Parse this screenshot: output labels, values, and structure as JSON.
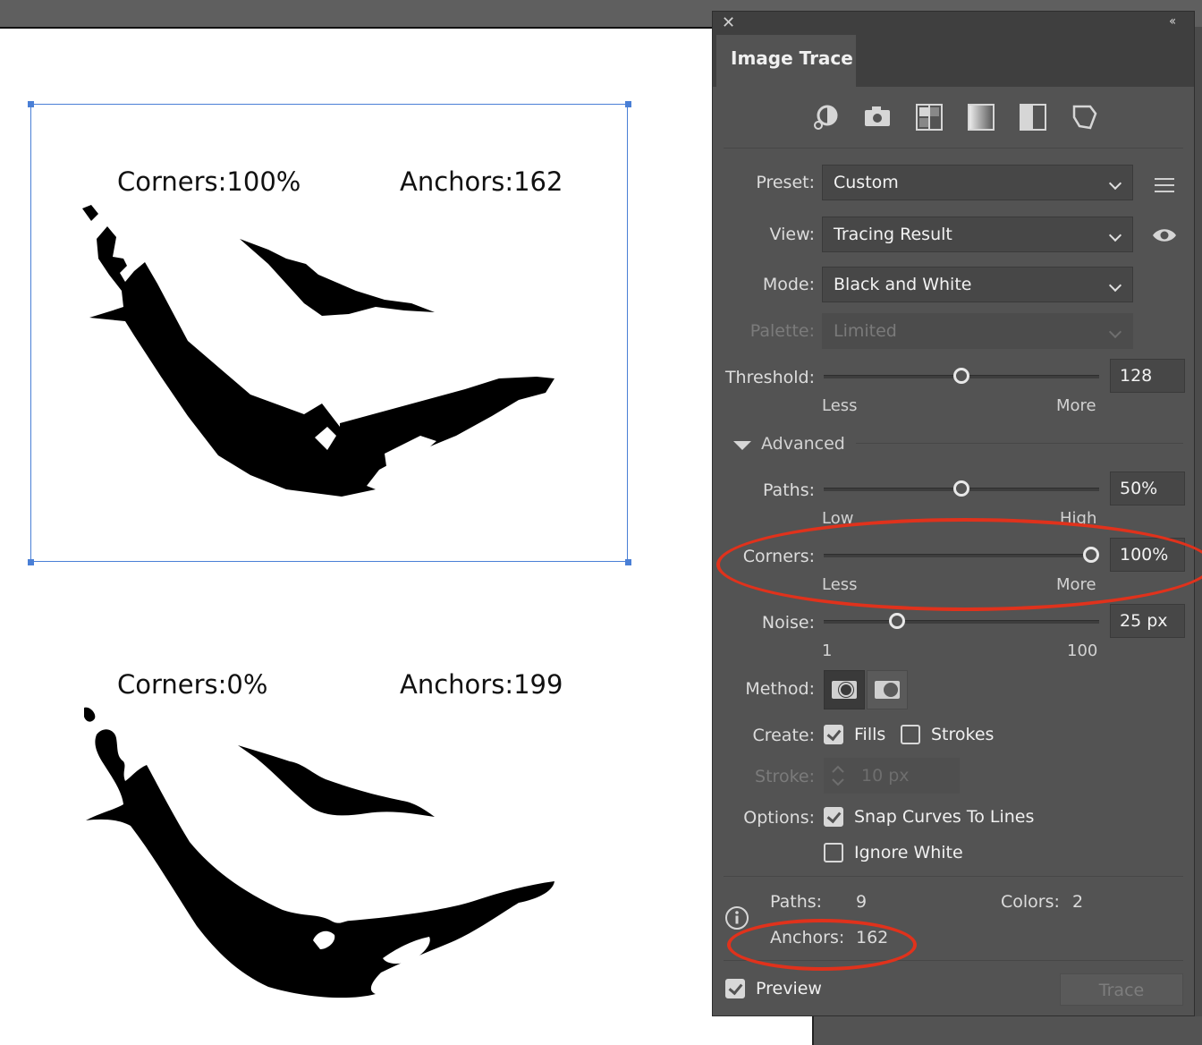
{
  "canvas": {
    "top_corners_label": "Corners:100%",
    "top_anchors_label": "Anchors:162",
    "bottom_corners_label": "Corners:0%",
    "bottom_anchors_label": "Anchors:199"
  },
  "panel": {
    "title": "Image Trace",
    "icons": [
      "auto-color-icon",
      "high-color-icon",
      "low-color-icon",
      "grayscale-icon",
      "black-white-icon",
      "outline-icon"
    ],
    "preset": {
      "label": "Preset:",
      "value": "Custom"
    },
    "view": {
      "label": "View:",
      "value": "Tracing Result"
    },
    "mode": {
      "label": "Mode:",
      "value": "Black and White"
    },
    "palette": {
      "label": "Palette:",
      "value": "Limited"
    },
    "threshold": {
      "label": "Threshold:",
      "value": "128",
      "min_label": "Less",
      "max_label": "More",
      "level": 0.5
    },
    "advanced": {
      "label": "Advanced"
    },
    "paths": {
      "label": "Paths:",
      "value": "50%",
      "min_label": "Low",
      "max_label": "High",
      "level": 0.5
    },
    "corners": {
      "label": "Corners:",
      "value": "100%",
      "min_label": "Less",
      "max_label": "More",
      "level": 1.0
    },
    "noise": {
      "label": "Noise:",
      "value": "25 px",
      "min_label": "1",
      "max_label": "100",
      "level": 0.25
    },
    "method": {
      "label": "Method:"
    },
    "create": {
      "label": "Create:",
      "fills": "Fills",
      "fills_checked": true,
      "strokes": "Strokes",
      "strokes_checked": false
    },
    "stroke": {
      "label": "Stroke:",
      "value": "10 px"
    },
    "options": {
      "label": "Options:",
      "snap": "Snap Curves To Lines",
      "snap_checked": true,
      "ignore_white": "Ignore White",
      "ignore_white_checked": false
    },
    "stats": {
      "paths_label": "Paths:",
      "paths_value": "9",
      "colors_label": "Colors:",
      "colors_value": "2",
      "anchors_label": "Anchors:",
      "anchors_value": "162"
    },
    "preview": {
      "label": "Preview",
      "checked": true
    },
    "trace_button": "Trace"
  },
  "colors": {
    "panel_bg": "#535353",
    "highlight_ellipse": "#e0321c",
    "selection": "#4a7fd6"
  }
}
